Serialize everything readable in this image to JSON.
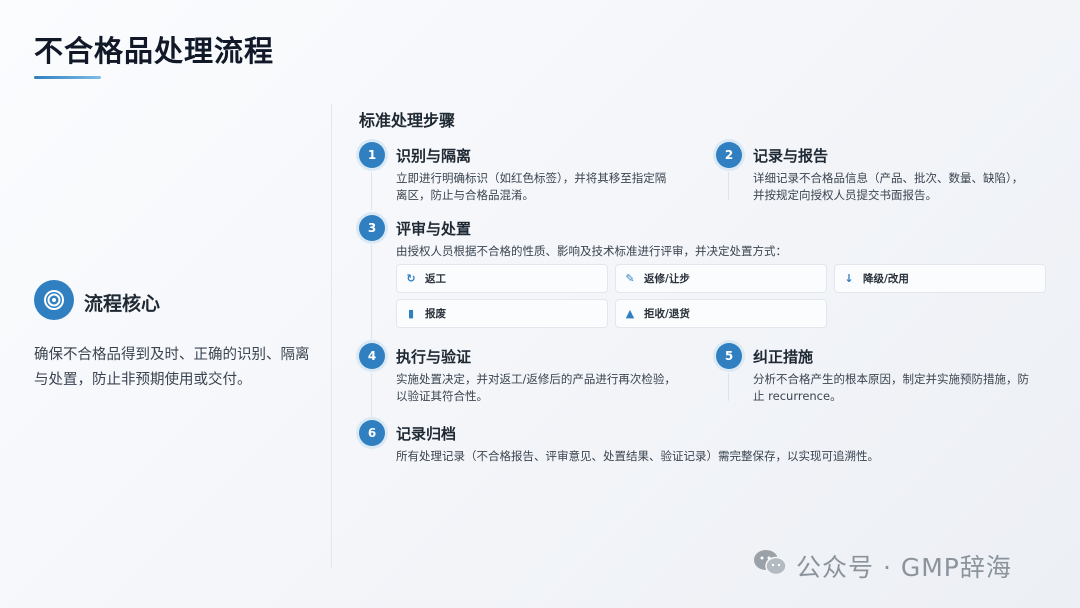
{
  "header": {
    "title": "不合格品处理流程"
  },
  "core": {
    "icon": "target-icon",
    "title": "流程核心",
    "description": "确保不合格品得到及时、正确的识别、隔离与处置，防止非预期使用或交付。"
  },
  "section": {
    "title": "标准处理步骤"
  },
  "steps": [
    {
      "num": "1",
      "title": "识别与隔离",
      "desc_line1": "立即进行明确标识（如红色标签），并将其移至指定隔",
      "desc_line2": "离区，防止与合格品混淆。"
    },
    {
      "num": "2",
      "title": "记录与报告",
      "desc_line1": "详细记录不合格品信息（产品、批次、数量、缺陷），",
      "desc_line2": "并按规定向授权人员提交书面报告。"
    },
    {
      "num": "3",
      "title": "评审与处置",
      "desc_line1": "由授权人员根据不合格的性质、影响及技术标准进行评审，并决定处置方式：",
      "desc_line2": ""
    },
    {
      "num": "4",
      "title": "执行与验证",
      "desc_line1": "实施处置决定，并对返工/返修后的产品进行再次检验，",
      "desc_line2": "以验证其符合性。"
    },
    {
      "num": "5",
      "title": "纠正措施",
      "desc_line1": "分析不合格产生的根本原因，制定并实施预防措施，防",
      "desc_line2": "止 recurrence。"
    },
    {
      "num": "6",
      "title": "记录归档",
      "desc_line1": "所有处理记录（不合格报告、评审意见、处置结果、验证记录）需完整保存，以实现可追溯性。",
      "desc_line2": ""
    }
  ],
  "disposition_options": [
    {
      "icon": "rework-icon",
      "label": "返工"
    },
    {
      "icon": "repair-concession-icon",
      "label": "返修/让步"
    },
    {
      "icon": "downgrade-icon",
      "label": "降级/改用"
    },
    {
      "icon": "scrap-icon",
      "label": "报废"
    },
    {
      "icon": "reject-return-icon",
      "label": "拒收/退货"
    }
  ],
  "watermark": {
    "text": "公众号 · GMP辞海",
    "icon": "wechat-icon"
  },
  "colors": {
    "accent": "#2f7fc1",
    "title": "#111827",
    "text": "#3a4450"
  }
}
